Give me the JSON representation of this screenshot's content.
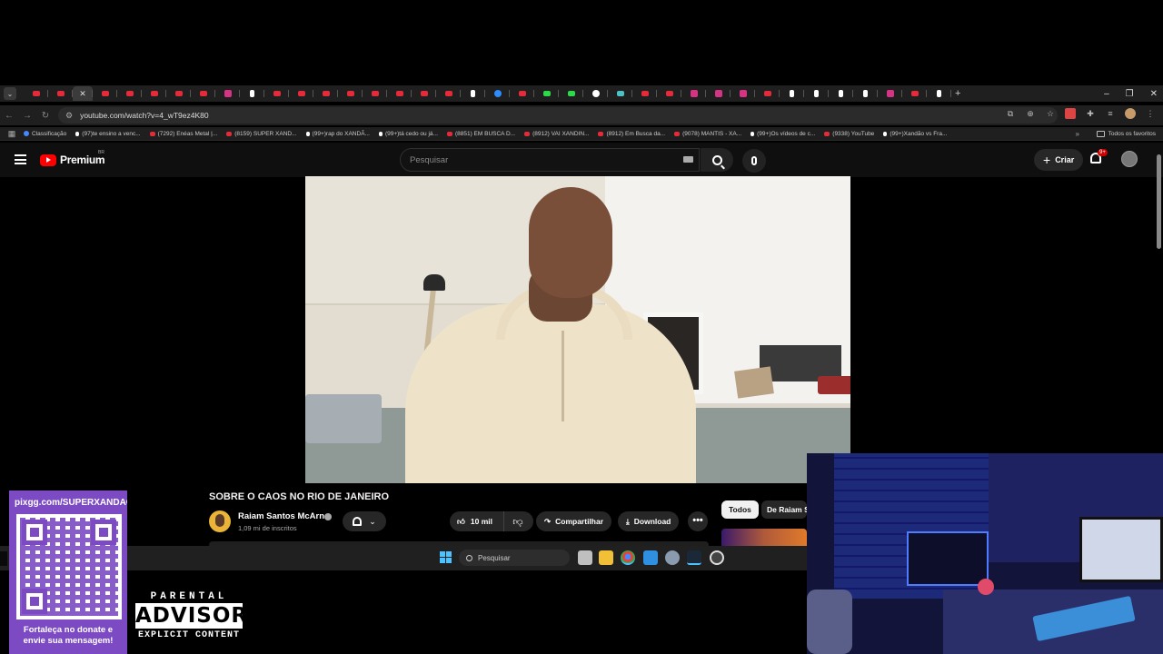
{
  "browser": {
    "tabs": [
      {
        "icon": "youtube"
      },
      {
        "icon": "youtube"
      },
      {
        "icon": "youtube"
      },
      {
        "icon": "youtube"
      },
      {
        "icon": "youtube"
      },
      {
        "icon": "youtube"
      },
      {
        "icon": "youtube"
      },
      {
        "icon": "instagram"
      },
      {
        "icon": "tiktok"
      },
      {
        "icon": "youtube"
      },
      {
        "icon": "youtube"
      },
      {
        "icon": "youtube"
      },
      {
        "icon": "youtube"
      },
      {
        "icon": "youtube"
      },
      {
        "icon": "youtube"
      },
      {
        "icon": "youtube"
      },
      {
        "icon": "youtube"
      },
      {
        "icon": "tiktok"
      },
      {
        "icon": "telegram"
      },
      {
        "icon": "youtube"
      },
      {
        "icon": "kick"
      },
      {
        "icon": "kick"
      },
      {
        "icon": "google"
      },
      {
        "icon": "code"
      },
      {
        "icon": "youtube"
      },
      {
        "icon": "youtube"
      },
      {
        "icon": "instagram"
      },
      {
        "icon": "instagram"
      },
      {
        "icon": "instagram"
      },
      {
        "icon": "youtube"
      },
      {
        "icon": "tiktok"
      },
      {
        "icon": "tiktok"
      },
      {
        "icon": "tiktok"
      },
      {
        "icon": "tiktok"
      },
      {
        "icon": "instagram"
      },
      {
        "icon": "youtube"
      },
      {
        "icon": "tiktok"
      }
    ],
    "new_tab_icon": "+",
    "window_controls": {
      "minimize": "–",
      "maximize": "❐",
      "close": "✕"
    },
    "url": "youtube.com/watch?v=4_wT9ez4K80",
    "bookmarks": [
      {
        "label": "Classificação",
        "icon": "calendar"
      },
      {
        "label": "(97)te ensino a venc...",
        "icon": "tiktok"
      },
      {
        "label": "(7292) Enéas Metal |...",
        "icon": "youtube"
      },
      {
        "label": "(8159) SUPER XAND...",
        "icon": "youtube"
      },
      {
        "label": "(99+)rap do XANDÃ...",
        "icon": "tiktok"
      },
      {
        "label": "(99+)tá cedo ou já...",
        "icon": "tiktok"
      },
      {
        "label": "(8851) EM BUSCA D...",
        "icon": "youtube"
      },
      {
        "label": "(8912) VAI XANDIN...",
        "icon": "youtube"
      },
      {
        "label": "(8912) Em Busca da...",
        "icon": "youtube"
      },
      {
        "label": "(9078) MANTIS - XA...",
        "icon": "youtube"
      },
      {
        "label": "(99+)Os vídeos de c...",
        "icon": "tiktok"
      },
      {
        "label": "(9338) YouTube",
        "icon": "youtube"
      },
      {
        "label": "(99+)Xandão vs Fra...",
        "icon": "tiktok"
      }
    ],
    "bookmarks_more": "»",
    "all_bookmarks": "Todos os favoritos"
  },
  "youtube": {
    "logo_text": "Premium",
    "country_code": "BR",
    "search_placeholder": "Pesquisar",
    "create_label": "Criar",
    "notifications_badge": "9+",
    "video": {
      "title": "SOBRE O CAOS NO RIO DE JANEIRO",
      "channel": "Raiam Santos McArn",
      "subscribers": "1,09 mi de inscritos",
      "likes": "10 mil",
      "share_label": "Compartilhar",
      "download_label": "Download",
      "more_label": "•••"
    },
    "chips": {
      "all": "Todos",
      "from": "De Raiam S"
    }
  },
  "taskbar": {
    "search_label": "Pesquisar",
    "apps": [
      "task-view",
      "file-explorer",
      "chrome",
      "vscode",
      "settings",
      "steam",
      "obs"
    ]
  },
  "overlay": {
    "donate_url": "pixgg.com/SUPERXANDAO",
    "donate_message_line1": "Fortaleça no donate e",
    "donate_message_line2": "envie sua mensagem!",
    "advisory_top": "PARENTAL",
    "advisory_mid": "ADVISORY",
    "advisory_bot": "EXPLICIT CONTENT"
  },
  "colors": {
    "youtube_red": "#ff0000",
    "browser_bg": "#1f1f1f",
    "yt_bg": "#0f0f0f",
    "donate_purple": "#7c4bc4"
  }
}
